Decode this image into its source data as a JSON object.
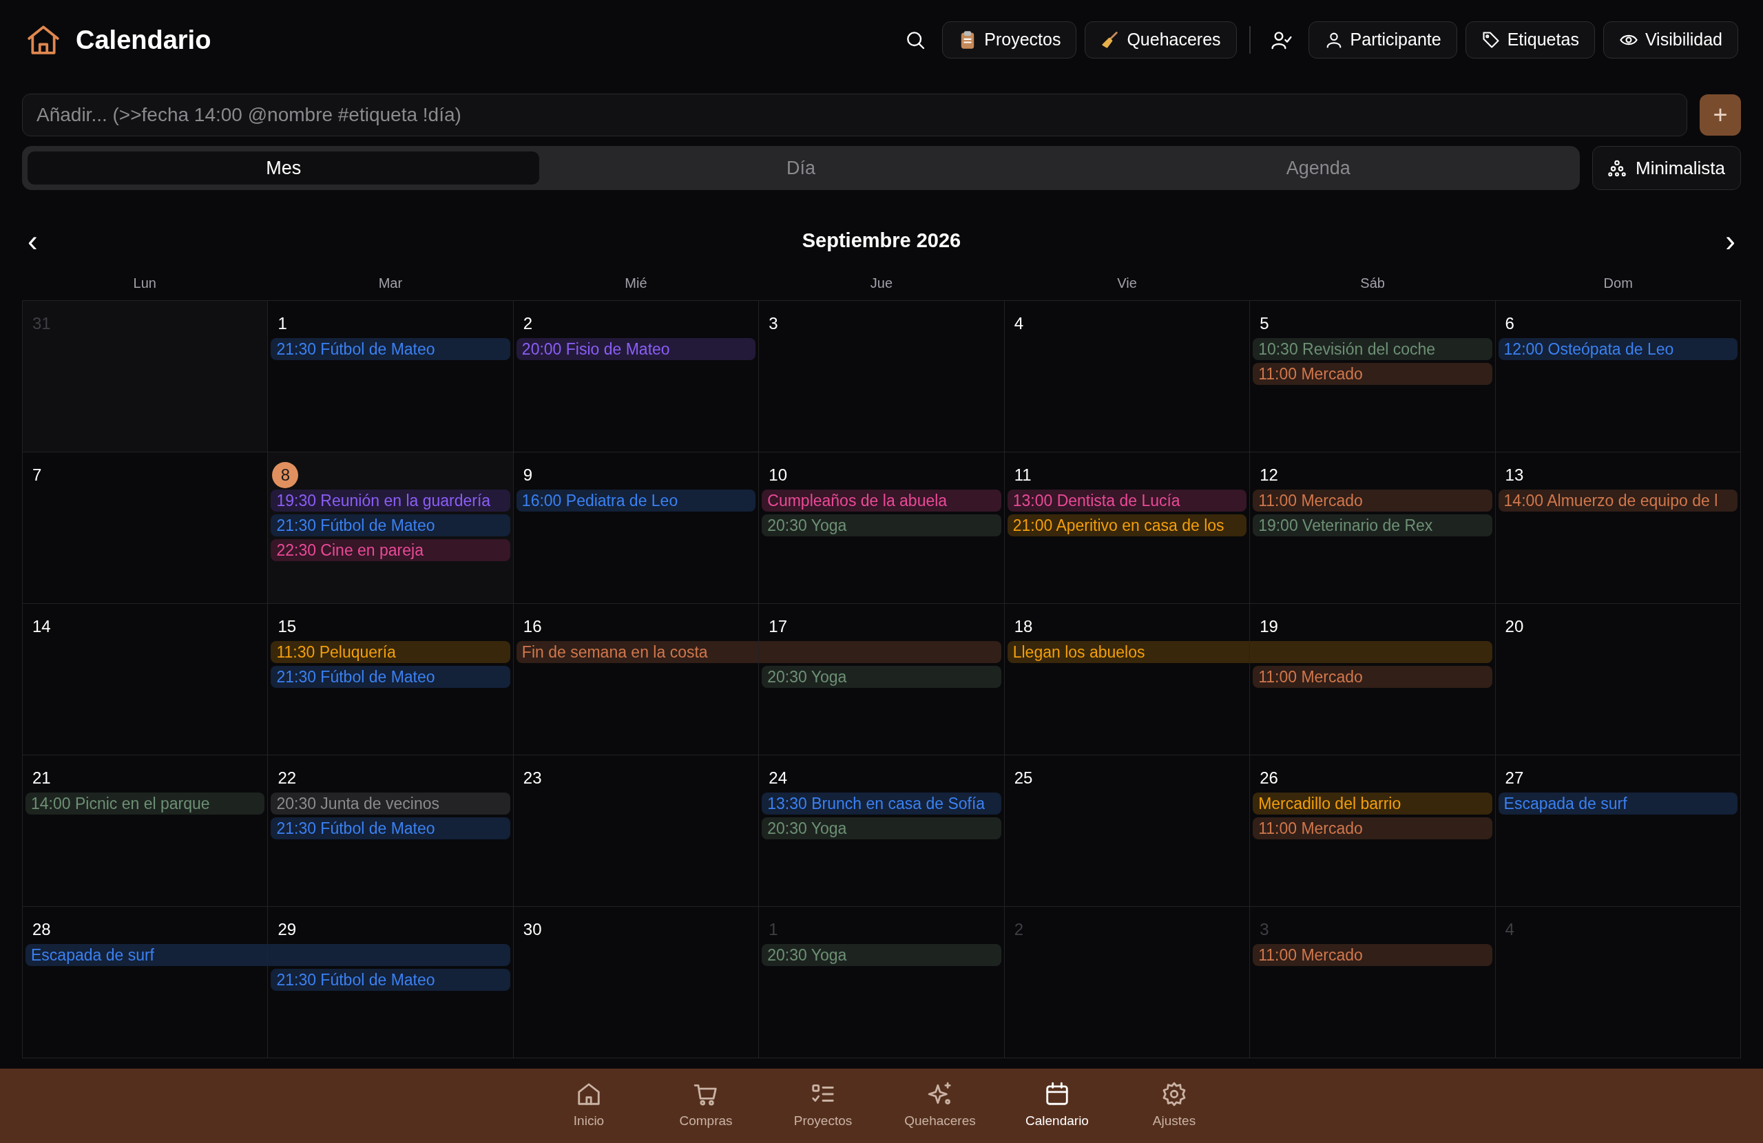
{
  "header": {
    "title": "Calendario",
    "buttons": [
      {
        "kind": "search"
      },
      {
        "kind": "clipboard",
        "label": "Proyectos"
      },
      {
        "kind": "broom",
        "label": "Quehaceres"
      },
      {
        "kind": "user-check"
      },
      {
        "kind": "user",
        "label": "Participante"
      },
      {
        "kind": "tag",
        "label": "Etiquetas"
      },
      {
        "kind": "eye",
        "label": "Visibilidad"
      }
    ]
  },
  "add_field": {
    "placeholder": "Añadir... (>>fecha 14:00 @nombre #etiqueta !día)",
    "button": "+"
  },
  "view_tabs": [
    {
      "label": "Mes",
      "selected": true
    },
    {
      "label": "Día",
      "selected": false
    },
    {
      "label": "Agenda",
      "selected": false
    }
  ],
  "minimal_button": "Minimalista",
  "month": {
    "title": "Septiembre 2026",
    "prev": "‹",
    "next": "›"
  },
  "weekdays": [
    "Lun",
    "Mar",
    "Mié",
    "Jue",
    "Vie",
    "Sáb",
    "Dom"
  ],
  "weeks": [
    {
      "days": [
        {
          "label": "31",
          "outside": true,
          "today": false
        },
        {
          "label": "1",
          "outside": false,
          "today": false,
          "events": [
            {
              "text": "21:30 Fútbol de Mateo",
              "color": "#132139"
            }
          ]
        },
        {
          "label": "2",
          "outside": false,
          "today": false,
          "events": [
            {
              "text": "20:00 Fisio de Mateo",
              "color": "#231a3a"
            }
          ]
        },
        {
          "label": "3",
          "outside": false,
          "today": false
        },
        {
          "label": "4",
          "outside": false,
          "today": false
        },
        {
          "label": "5",
          "outside": false,
          "today": false,
          "events": [
            {
              "text": "10:30 Revisión del coche",
              "color": "#1d2420"
            },
            {
              "text": "11:00 Mercado",
              "color": "#311f18"
            }
          ]
        },
        {
          "label": "6",
          "outside": false,
          "today": false,
          "events": [
            {
              "text": "12:00 Osteópata de Leo",
              "color": "#132139"
            }
          ]
        }
      ]
    },
    {
      "days": [
        {
          "label": "7",
          "outside": false,
          "today": false
        },
        {
          "label": "8",
          "outside": false,
          "today": true,
          "events": [
            {
              "text": "19:30 Reunión en la guardería",
              "color": "#231a3a"
            },
            {
              "text": "21:30 Fútbol de Mateo",
              "color": "#132139"
            },
            {
              "text": "22:30 Cine en pareja",
              "color": "#361627"
            }
          ]
        },
        {
          "label": "9",
          "outside": false,
          "today": false,
          "events": [
            {
              "text": "16:00 Pediatra de Leo",
              "color": "#132139"
            }
          ]
        },
        {
          "label": "10",
          "outside": false,
          "today": false,
          "events": [
            {
              "text": "Cumpleaños de la abuela",
              "color": "#361627"
            },
            {
              "text": "20:30 Yoga",
              "color": "#1d2420"
            }
          ]
        },
        {
          "label": "11",
          "outside": false,
          "today": false,
          "events": [
            {
              "text": "13:00 Dentista de Lucía",
              "color": "#361627"
            },
            {
              "text": "21:00 Aperitivo en casa de los",
              "color": "#38270b"
            }
          ]
        },
        {
          "label": "12",
          "outside": false,
          "today": false,
          "events": [
            {
              "text": "11:00 Mercado",
              "color": "#311f18"
            },
            {
              "text": "19:00 Veterinario de Rex",
              "color": "#1d2420"
            }
          ]
        },
        {
          "label": "13",
          "outside": false,
          "today": false,
          "events": [
            {
              "text": "14:00 Almuerzo de equipo de l",
              "color": "#311f18"
            }
          ]
        }
      ]
    },
    {
      "days": [
        {
          "label": "14",
          "outside": false,
          "today": false
        },
        {
          "label": "15",
          "outside": false,
          "today": false,
          "events": [
            {
              "text": "11:30 Peluquería",
              "color": "#38270b"
            },
            {
              "text": "21:30 Fútbol de Mateo",
              "color": "#132139"
            }
          ]
        },
        {
          "label": "16",
          "outside": false,
          "today": false,
          "events": [
            {
              "text": "Fin de semana en la costa",
              "color": "#311f18",
              "continues": true
            }
          ]
        },
        {
          "label": "17",
          "outside": false,
          "today": false,
          "events": [
            {
              "continuation": true,
              "color": "#311f18"
            },
            {
              "text": "20:30 Yoga",
              "color": "#1d2420"
            }
          ]
        },
        {
          "label": "18",
          "outside": false,
          "today": false,
          "events": [
            {
              "text": "Llegan los abuelos",
              "color": "#38270b",
              "continues": true
            }
          ]
        },
        {
          "label": "19",
          "outside": false,
          "today": false,
          "events": [
            {
              "continuation": true,
              "color": "#38270b"
            },
            {
              "text": "11:00 Mercado",
              "color": "#311f18"
            }
          ]
        },
        {
          "label": "20",
          "outside": false,
          "today": false
        }
      ]
    },
    {
      "days": [
        {
          "label": "21",
          "outside": false,
          "today": false,
          "events": [
            {
              "text": "14:00 Picnic en el parque",
              "color": "#1d2420"
            }
          ]
        },
        {
          "label": "22",
          "outside": false,
          "today": false,
          "events": [
            {
              "text": "20:30 Junta de vecinos",
              "color": "#232325"
            },
            {
              "text": "21:30 Fútbol de Mateo",
              "color": "#132139"
            }
          ]
        },
        {
          "label": "23",
          "outside": false,
          "today": false
        },
        {
          "label": "24",
          "outside": false,
          "today": false,
          "events": [
            {
              "text": "13:30 Brunch en casa de Sofía",
              "color": "#132139"
            },
            {
              "text": "20:30 Yoga",
              "color": "#1d2420"
            }
          ]
        },
        {
          "label": "25",
          "outside": false,
          "today": false
        },
        {
          "label": "26",
          "outside": false,
          "today": false,
          "events": [
            {
              "text": "Mercadillo del barrio",
              "color": "#38270b"
            },
            {
              "text": "11:00 Mercado",
              "color": "#311f18"
            }
          ]
        },
        {
          "label": "27",
          "outside": false,
          "today": false,
          "events": [
            {
              "text": "Escapada de surf",
              "color": "#132139"
            }
          ]
        }
      ]
    },
    {
      "days": [
        {
          "label": "28",
          "outside": false,
          "today": false,
          "events": [
            {
              "text": "Escapada de surf",
              "color": "#132139",
              "continues": true
            }
          ]
        },
        {
          "label": "29",
          "outside": false,
          "today": false,
          "events": [
            {
              "continuation": true,
              "color": "#132139"
            },
            {
              "text": "21:30 Fútbol de Mateo",
              "color": "#132139"
            }
          ]
        },
        {
          "label": "30",
          "outside": false,
          "today": false
        },
        {
          "label": "1",
          "outside": true,
          "today": false,
          "events": [
            {
              "text": "20:30 Yoga",
              "color": "#1d2420"
            }
          ]
        },
        {
          "label": "2",
          "outside": true,
          "today": false
        },
        {
          "label": "3",
          "outside": true,
          "today": false,
          "events": [
            {
              "text": "11:00 Mercado",
              "color": "#311f18"
            }
          ]
        },
        {
          "label": "4",
          "outside": true,
          "today": false
        }
      ]
    }
  ],
  "bottom_nav": [
    {
      "kind": "home",
      "label": "Inicio",
      "selected": false
    },
    {
      "kind": "cart",
      "label": "Compras",
      "selected": false
    },
    {
      "kind": "list",
      "label": "Proyectos",
      "selected": false
    },
    {
      "kind": "sparkles",
      "label": "Quehaceres",
      "selected": false
    },
    {
      "kind": "calendar",
      "label": "Calendario",
      "selected": true
    },
    {
      "kind": "gear",
      "label": "Ajustes",
      "selected": false
    }
  ]
}
